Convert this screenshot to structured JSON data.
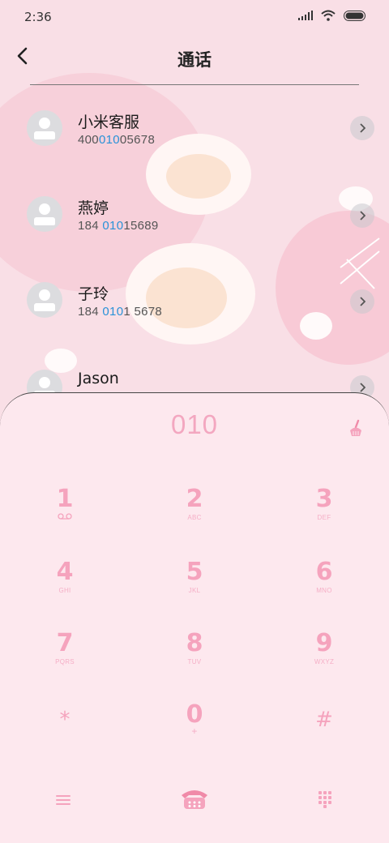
{
  "status": {
    "time": "2:36"
  },
  "header": {
    "title": "通话"
  },
  "contacts": [
    {
      "name": "小米客服",
      "number_pre": "400",
      "number_match": "010",
      "number_post": "05678"
    },
    {
      "name": "燕婷",
      "number_pre": "184 ",
      "number_match": "010",
      "number_post": "15689"
    },
    {
      "name": "子玲",
      "number_pre": "184 ",
      "number_match": "010",
      "number_post": "1 5678"
    },
    {
      "name": "Jason",
      "number_pre": "",
      "number_match": "",
      "number_post": ""
    }
  ],
  "dialpad": {
    "digits": "010",
    "keys": [
      {
        "num": "1",
        "sub": "voicemail-icon"
      },
      {
        "num": "2",
        "sub": "ABC"
      },
      {
        "num": "3",
        "sub": "DEF"
      },
      {
        "num": "4",
        "sub": "GHI"
      },
      {
        "num": "5",
        "sub": "JKL"
      },
      {
        "num": "6",
        "sub": "MNO"
      },
      {
        "num": "7",
        "sub": "PQRS"
      },
      {
        "num": "8",
        "sub": "TUV"
      },
      {
        "num": "9",
        "sub": "WXYZ"
      },
      {
        "num": "*",
        "sub": ""
      },
      {
        "num": "0",
        "sub": "+"
      },
      {
        "num": "#",
        "sub": ""
      }
    ]
  },
  "colors": {
    "accent": "#f5a3bd",
    "match": "#2a92d8",
    "background": "#f9dfe6"
  }
}
